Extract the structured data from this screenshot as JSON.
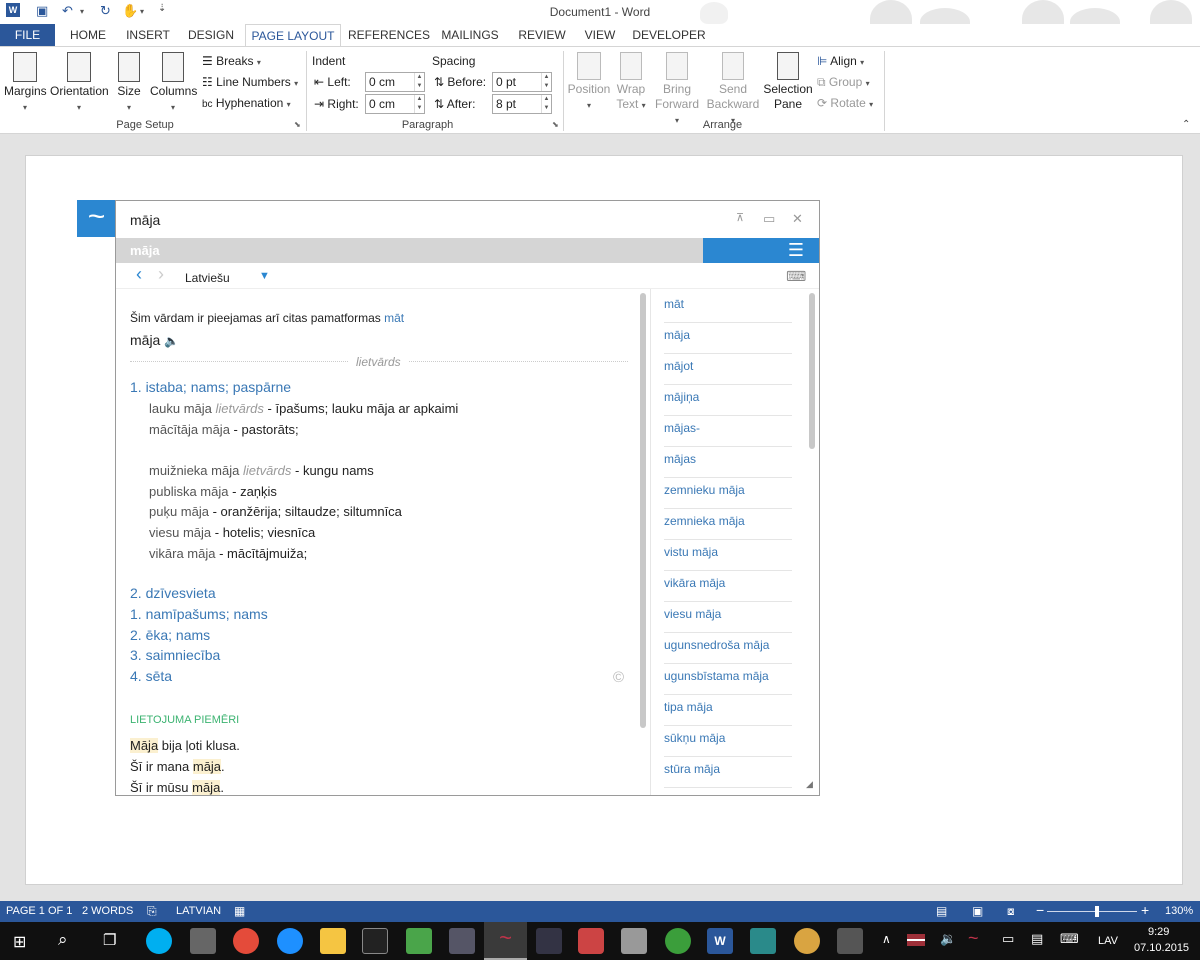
{
  "window": {
    "title": "Document1 - Word"
  },
  "tabs": [
    "FILE",
    "HOME",
    "INSERT",
    "DESIGN",
    "PAGE LAYOUT",
    "REFERENCES",
    "MAILINGS",
    "REVIEW",
    "VIEW",
    "DEVELOPER"
  ],
  "ribbon": {
    "page_setup": {
      "margins": "Margins",
      "orientation": "Orientation",
      "size": "Size",
      "columns": "Columns",
      "breaks": "Breaks",
      "line_numbers": "Line Numbers",
      "hyphenation": "Hyphenation",
      "label": "Page Setup"
    },
    "paragraph": {
      "indent": "Indent",
      "spacing": "Spacing",
      "left_label": "Left:",
      "right_label": "Right:",
      "before_label": "Before:",
      "after_label": "After:",
      "left_value": "0 cm",
      "right_value": "0 cm",
      "before_value": "0 pt",
      "after_value": "8 pt",
      "label": "Paragraph"
    },
    "arrange": {
      "position": "Position",
      "wrap1": "Wrap",
      "wrap2": "Text",
      "bring1": "Bring",
      "bring2": "Forward",
      "send1": "Send",
      "send2": "Backward",
      "sel1": "Selection",
      "sel2": "Pane",
      "align": "Align",
      "group": "Group",
      "rotate": "Rotate",
      "label": "Arrange"
    }
  },
  "dictionary": {
    "logo": "~",
    "search_word": "māja",
    "bar_word": "māja",
    "language": "Latviešu",
    "other_forms_text": "Šim vārdam ir pieejamas arī citas pamatformas",
    "other_forms_link": "māt",
    "headword": "māja",
    "pos": "lietvārds",
    "sense1": "1. istaba; nams; paspārne",
    "ex1_term": "lauku māja",
    "ex1_pos": "lietvārds",
    "ex1_def": "- īpašums; lauku māja ar apkaimi",
    "ex2_term": "mācītāja māja",
    "ex2_def": "- pastorāts;",
    "ex3_term": "muižnieka māja",
    "ex3_pos": "lietvārds",
    "ex3_def": "- kungu nams",
    "ex4_term": "publiska māja",
    "ex4_def": "- zaņķis",
    "ex5_term": "puķu māja",
    "ex5_def": "- oranžērija; siltaudze; siltumnīca",
    "ex6_term": "viesu māja",
    "ex6_def": "- hotelis; viesnīca",
    "ex7_term": "vikāra māja",
    "ex7_def": "- mācītājmuiža;",
    "sense2": "2. dzīvesvieta",
    "sense2_1": "1. namīpašums; nams",
    "sense2_2": "2. ēka; nams",
    "sense2_3": "3. saimniecība",
    "sense2_4": "4. sēta",
    "copyright": "©",
    "usage_header": "LIETOJUMA PIEMĒRI",
    "usage1_hl": "Māja",
    "usage1_rest": " bija ļoti klusa.",
    "usage2_pre": "Šī ir mana ",
    "usage2_hl": "māja",
    "usage2_post": ".",
    "usage3_pre": "Šī ir mūsu ",
    "usage3_hl": "māja",
    "usage3_post": ".",
    "related": [
      "māt",
      "māja",
      "mājot",
      "mājiņa",
      "mājas-",
      "mājas",
      "zemnieku māja",
      "zemnieka māja",
      "vistu māja",
      "vikāra māja",
      "viesu māja",
      "ugunsnedroša māja",
      "ugunsbīstama māja",
      "tipa māja",
      "sūkņu māja",
      "stūra māja"
    ]
  },
  "status": {
    "page": "PAGE 1 OF 1",
    "words": "2 WORDS",
    "language": "LATVIAN",
    "zoom": "130%"
  },
  "taskbar": {
    "lang": "LAV",
    "time": "9:29",
    "date": "07.10.2015"
  }
}
